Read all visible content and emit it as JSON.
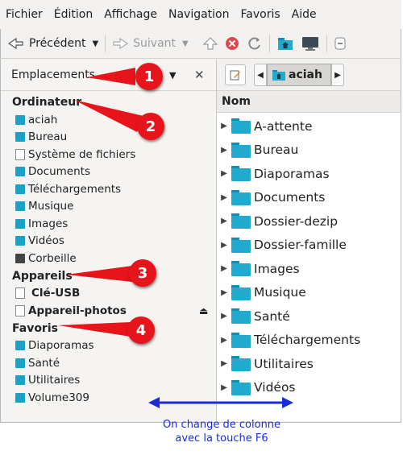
{
  "menubar": [
    "Fichier",
    "Édition",
    "Affichage",
    "Navigation",
    "Favoris",
    "Aide"
  ],
  "toolbar": {
    "back_label": "Précédent",
    "forward_label": "Suivant"
  },
  "sidebar": {
    "header": "Emplacements",
    "sections": [
      {
        "title": "Ordinateur",
        "items": [
          {
            "label": "aciah",
            "icon": "home-folder-icon"
          },
          {
            "label": "Bureau",
            "icon": "desktop-folder-icon"
          },
          {
            "label": "Système de fichiers",
            "icon": "drive-icon"
          },
          {
            "label": "Documents",
            "icon": "folder-icon"
          },
          {
            "label": "Téléchargements",
            "icon": "folder-icon"
          },
          {
            "label": "Musique",
            "icon": "music-folder-icon"
          },
          {
            "label": "Images",
            "icon": "pictures-folder-icon"
          },
          {
            "label": "Vidéos",
            "icon": "videos-folder-icon"
          },
          {
            "label": "Corbeille",
            "icon": "trash-icon"
          }
        ]
      },
      {
        "title": "Appareils",
        "items": [
          {
            "label": "Clé-USB",
            "icon": "usb-drive-icon"
          },
          {
            "label": "Appareil-photos",
            "icon": "camera-drive-icon"
          }
        ]
      },
      {
        "title": "Favoris",
        "items": [
          {
            "label": "Diaporamas",
            "icon": "folder-icon"
          },
          {
            "label": "Santé",
            "icon": "folder-icon"
          },
          {
            "label": "Utilitaires",
            "icon": "folder-icon"
          },
          {
            "label": "Volume309",
            "icon": "folder-icon"
          }
        ]
      }
    ]
  },
  "pathbar": {
    "current": "aciah"
  },
  "filelist": {
    "column": "Nom",
    "rows": [
      "A-attente",
      "Bureau",
      "Diaporamas",
      "Documents",
      "Dossier-dezip",
      "Dossier-famille",
      "Images",
      "Musique",
      "Santé",
      "Téléchargements",
      "Utilitaires",
      "Vidéos"
    ]
  },
  "annotations": {
    "badges": [
      "1",
      "2",
      "3",
      "4"
    ],
    "caption_line1": "On change de colonne",
    "caption_line2": "avec la touche  F6"
  },
  "colors": {
    "annotation_red": "#e8141c",
    "annotation_blue": "#1a2cd6",
    "folder": "#20aad0"
  }
}
